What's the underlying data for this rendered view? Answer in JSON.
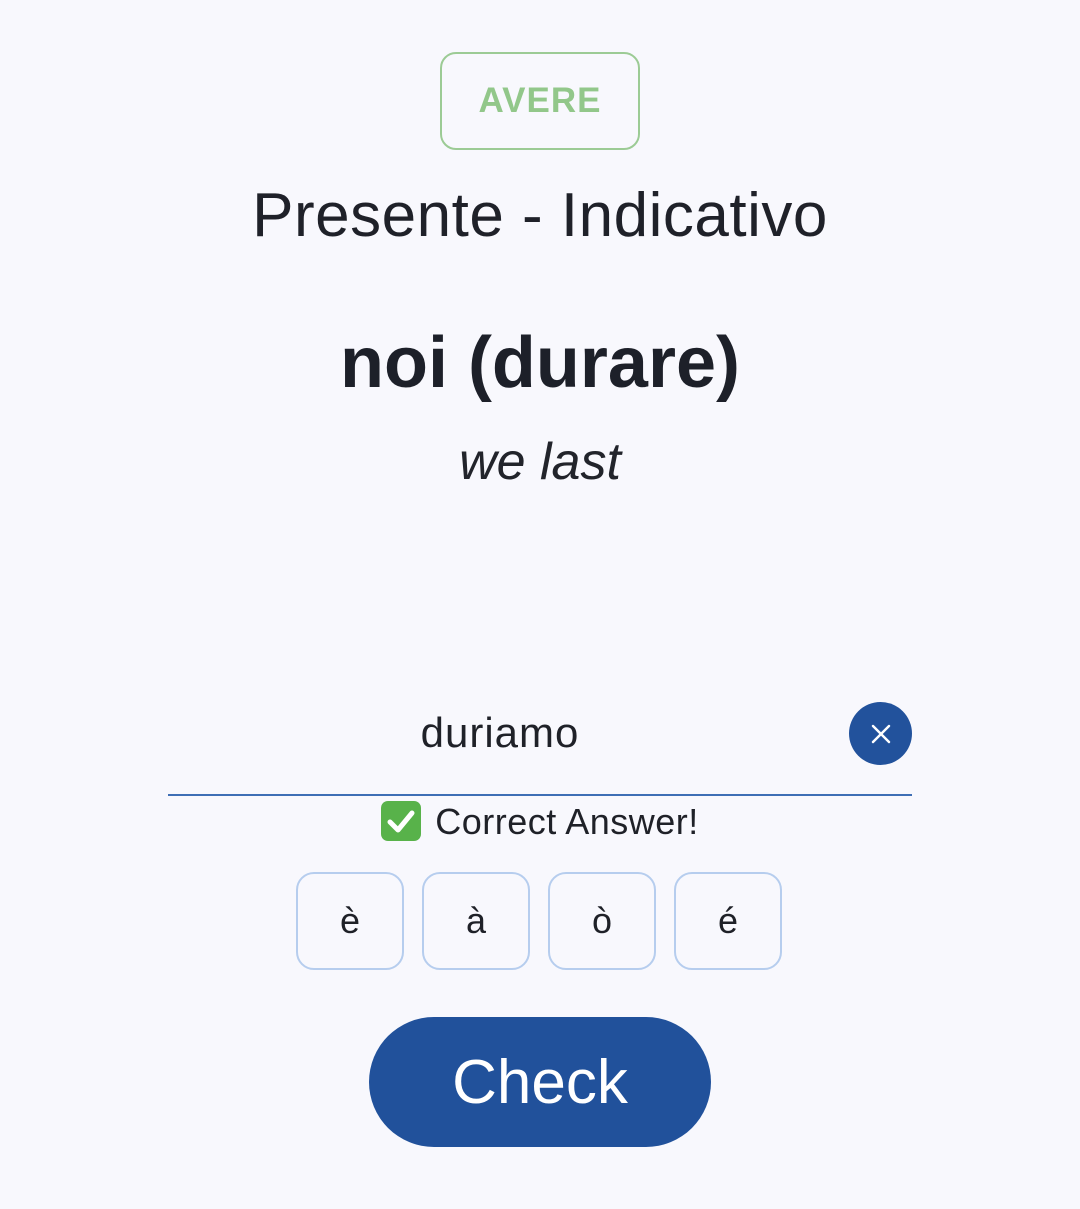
{
  "verb_badge": "AVERE",
  "tense": "Presente - Indicativo",
  "prompt": "noi (durare)",
  "translation": "we last",
  "answer": {
    "value": "duriamo",
    "clear_icon": "close-icon"
  },
  "status": {
    "icon": "check-mark-icon",
    "text": "Correct Answer!",
    "color": "#58b24a"
  },
  "accent_keys": [
    "è",
    "à",
    "ò",
    "é"
  ],
  "check_button": "Check",
  "colors": {
    "primary": "#21519b",
    "badge_green": "#92c78a",
    "background": "#f8f8fd"
  }
}
